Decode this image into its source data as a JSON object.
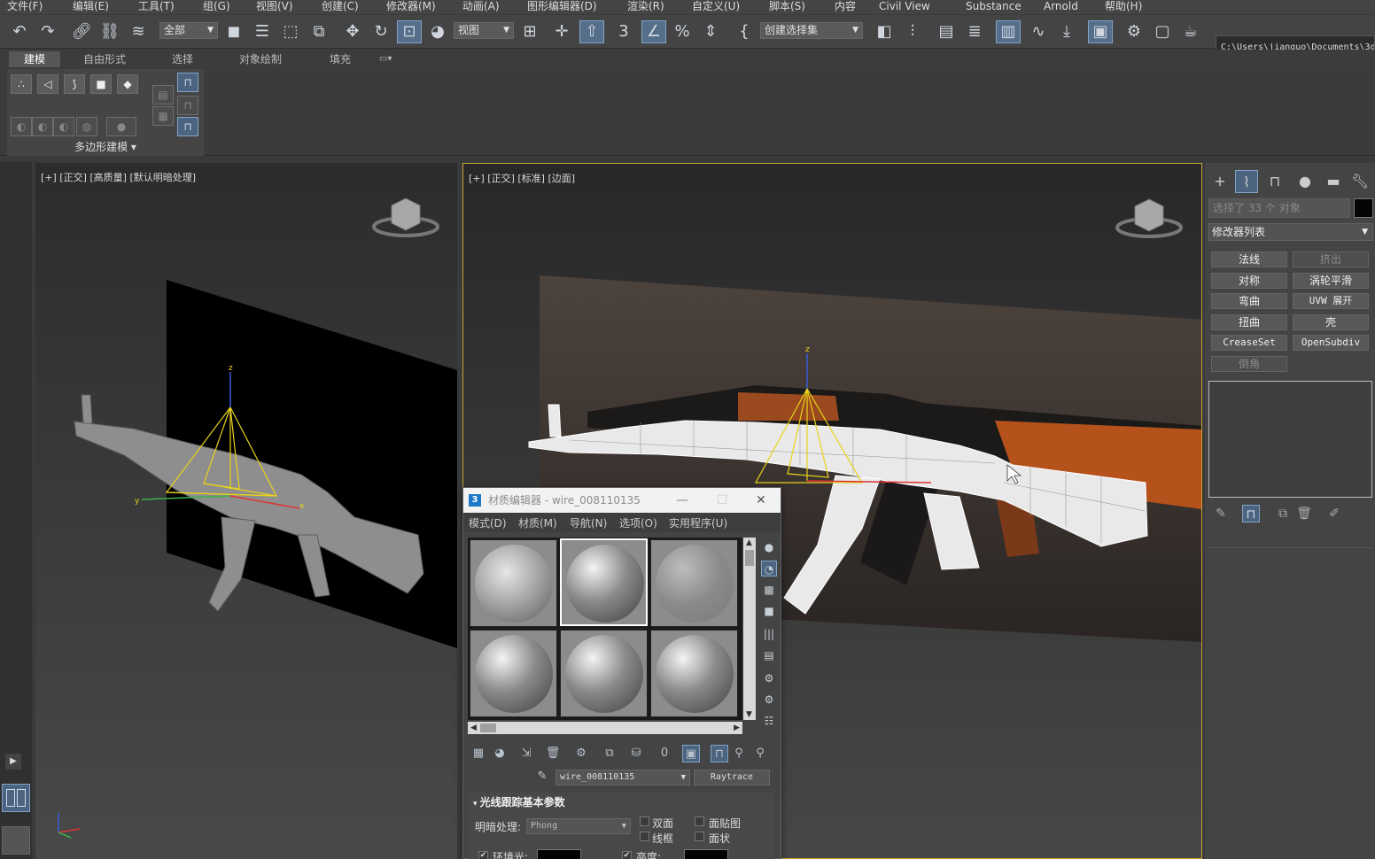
{
  "menu": [
    "文件(F)",
    "编辑(E)",
    "工具(T)",
    "组(G)",
    "视图(V)",
    "创建(C)",
    "修改器(M)",
    "动画(A)",
    "图形编辑器(D)",
    "渲染(R)",
    "自定义(U)",
    "脚本(S)",
    "内容",
    "Civil View",
    "Substance",
    "Arnold",
    "帮助(H)"
  ],
  "toolbar": {
    "filter_value": "全部",
    "coord_value": "视图",
    "selection_set_value": "创建选择集",
    "path": "C:\\Users\\jianguo\\Documents\\3d"
  },
  "ribbon": {
    "tabs": [
      "建模",
      "自由形式",
      "选择",
      "对象绘制",
      "填充"
    ],
    "group_label": "多边形建模"
  },
  "viewport_left": {
    "label": "[+] [正交] [高质量] [默认明暗处理]"
  },
  "viewport_right": {
    "label": "[+] [正交] [标准] [边面]"
  },
  "command_panel": {
    "selection_text": "选择了 33 个 对象",
    "modifier_list": "修改器列表",
    "buttons": [
      "法线",
      "挤出",
      "对称",
      "涡轮平滑",
      "弯曲",
      "UVW 展开",
      "扭曲",
      "壳",
      "CreaseSet",
      "OpenSubdiv",
      "倒角"
    ]
  },
  "material_editor": {
    "title": "材质编辑器 - wire_008110135",
    "menu": [
      "模式(D)",
      "材质(M)",
      "导航(N)",
      "选项(O)",
      "实用程序(U)"
    ],
    "material_name": "wire_008110135",
    "material_type": "Raytrace",
    "rollout_title": "光线跟踪基本参数",
    "shading_label": "明暗处理:",
    "shading_value": "Phong",
    "options": [
      "双面",
      "面贴图",
      "线框",
      "面状"
    ],
    "ambient_label": "环境光:",
    "luminosity_label": "高度:"
  },
  "colors": {
    "accent": "#7fa4c8",
    "active_viewport_border": "#c9a233",
    "gizmo": "#e8d21a"
  }
}
